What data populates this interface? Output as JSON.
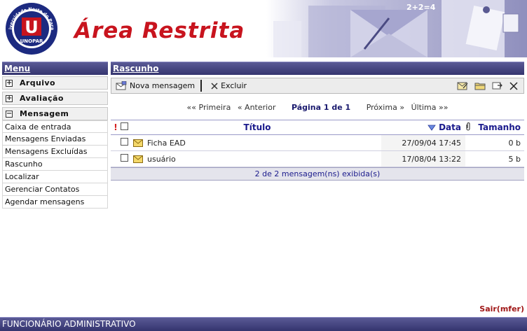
{
  "header": {
    "logo_text_top": "Universidade Norte do Paraná",
    "logo_letter": "U",
    "logo_label": "UNOPAR",
    "title": "Área Restrita",
    "banner_text": "2+2=4"
  },
  "sidebar": {
    "title": "Menu",
    "groups": [
      {
        "label": "Arquivo",
        "symbol": "+"
      },
      {
        "label": "Avaliação",
        "symbol": "+"
      },
      {
        "label": "Mensagem",
        "symbol": "−"
      }
    ],
    "items": [
      "Caixa de entrada",
      "Mensagens Enviadas",
      "Mensagens Excluídas",
      "Rascunho",
      "Localizar",
      "Gerenciar Contatos",
      "Agendar mensagens"
    ]
  },
  "main": {
    "title": "Rascunho",
    "toolbar": {
      "new_label": "Nova mensagem",
      "delete_label": "Excluir"
    },
    "pager": {
      "first": "«« Primeira",
      "previous": "« Anterior",
      "current": "Página 1 de 1",
      "next": "Próxima »",
      "last": "Última »»"
    },
    "table": {
      "flag_col": "!",
      "title_col": "Título",
      "date_col": "Data",
      "size_col": "Tamanho",
      "rows": [
        {
          "title": "Ficha EAD",
          "date": "27/09/04 17:45",
          "size": "0 b"
        },
        {
          "title": "usuário",
          "date": "17/08/04 13:22",
          "size": "5 b"
        }
      ],
      "footer": "2 de 2 mensagem(ns) exibida(s)"
    }
  },
  "logout": "Sair(mfer)",
  "status_bar": "FUNCIONÁRIO ADMINISTRATIVO",
  "colors": {
    "accent": "#c8141e",
    "bar": "#3c3c78",
    "link": "#1a1a8c"
  }
}
